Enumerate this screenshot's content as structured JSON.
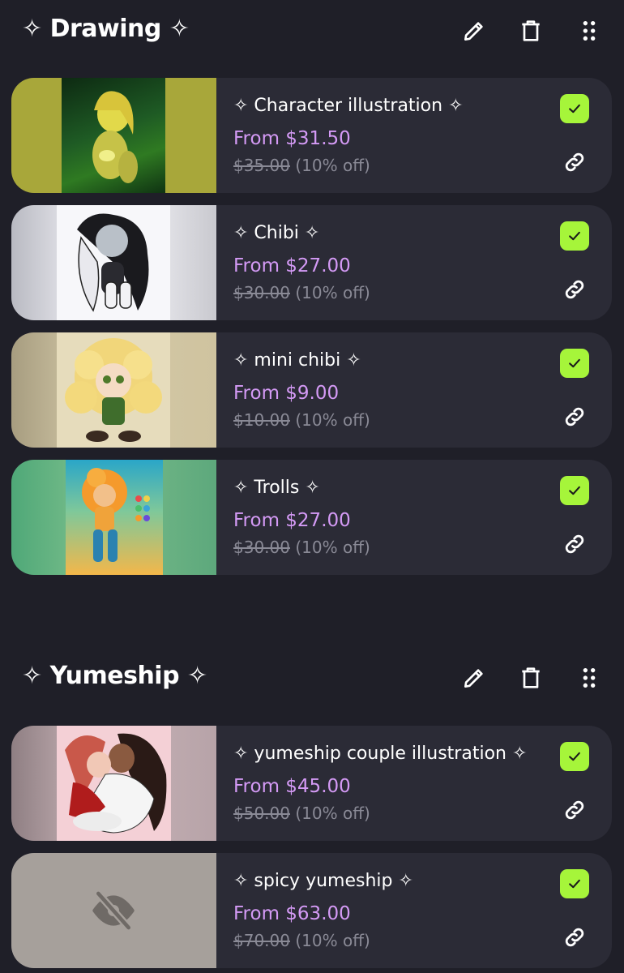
{
  "sections": [
    {
      "title": "✧ Drawing ✧",
      "actions": {
        "edit": "pencil-icon",
        "delete": "trash-icon",
        "reorder": "drag-handle-icon"
      },
      "items": [
        {
          "title": "✧ Character illustration ✧",
          "price": "From $31.50",
          "original": "$35.00",
          "discount": "(10% off)",
          "enabled": true
        },
        {
          "title": "✧ Chibi ✧",
          "price": "From $27.00",
          "original": "$30.00",
          "discount": "(10% off)",
          "enabled": true
        },
        {
          "title": "✧ mini chibi ✧",
          "price": "From $9.00",
          "original": "$10.00",
          "discount": "(10% off)",
          "enabled": true
        },
        {
          "title": "✧ Trolls ✧",
          "price": "From $27.00",
          "original": "$30.00",
          "discount": "(10% off)",
          "enabled": true
        }
      ]
    },
    {
      "title": "✧ Yumeship ✧",
      "actions": {
        "edit": "pencil-icon",
        "delete": "trash-icon",
        "reorder": "drag-handle-icon"
      },
      "items": [
        {
          "title": "✧ yumeship couple illustration ✧",
          "price": "From $45.00",
          "original": "$50.00",
          "discount": "(10% off)",
          "enabled": true
        },
        {
          "title": "✧ spicy yumeship ✧",
          "price": "From $63.00",
          "original": "$70.00",
          "discount": "(10% off)",
          "enabled": true,
          "hidden_thumbnail": true
        }
      ]
    }
  ],
  "colors": {
    "background": "#1f1f28",
    "card": "#2b2b36",
    "price": "#d49af5",
    "check": "#a6f53a",
    "muted": "#8a8a96"
  }
}
